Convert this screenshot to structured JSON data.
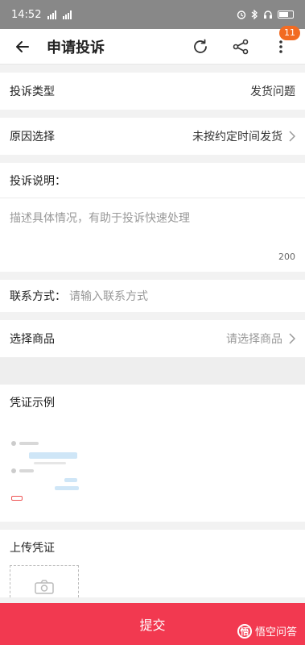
{
  "status_bar": {
    "time": "14:52"
  },
  "nav": {
    "title": "申请投诉",
    "badge_count": "11"
  },
  "complaint_type": {
    "label": "投诉类型",
    "value": "发货问题"
  },
  "reason": {
    "label": "原因选择",
    "value": "未按约定时间发货"
  },
  "description": {
    "label": "投诉说明：",
    "placeholder": "描述具体情况，有助于投诉快速处理",
    "char_limit": "200"
  },
  "contact": {
    "label": "联系方式：",
    "placeholder": "请输入联系方式"
  },
  "product": {
    "label": "选择商品",
    "placeholder": "请选择商品"
  },
  "evidence_example": {
    "label": "凭证示例"
  },
  "upload": {
    "label": "上传凭证"
  },
  "submit": {
    "label": "提交"
  },
  "watermark": {
    "logo_text": "悟",
    "text": "悟空问答"
  },
  "colors": {
    "accent": "#f23950",
    "badge": "#f26b22",
    "status_bar": "#888888"
  }
}
